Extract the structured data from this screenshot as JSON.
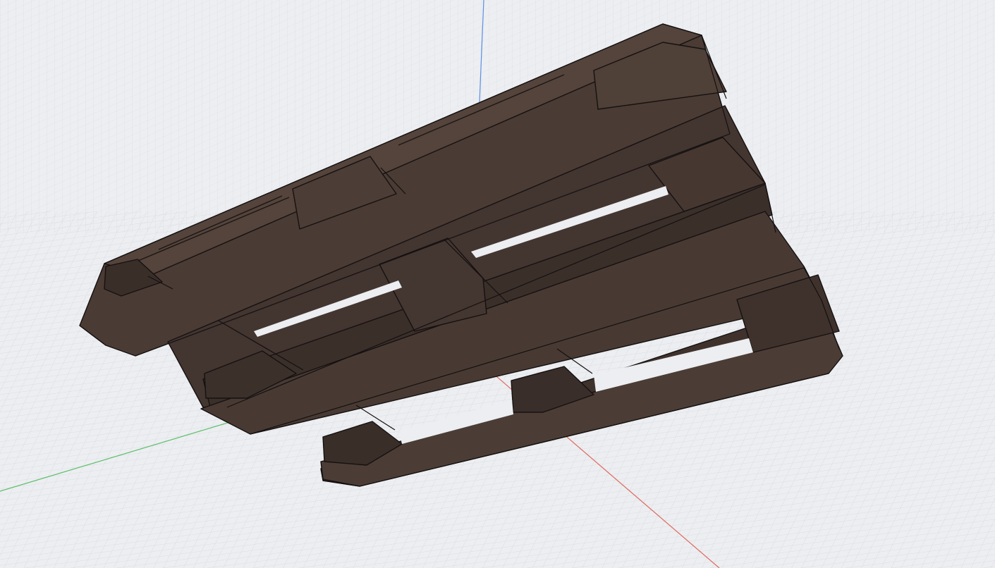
{
  "viewport": {
    "kind": "3d-model-view",
    "background_color": "#eceef1",
    "grid_color": "#c9ccd2",
    "axis_colors": {
      "x": "#e06a5e",
      "y": "#5bbf6a",
      "z": "#5b8ee6"
    }
  },
  "model": {
    "object": "pallet",
    "view": "underside-perspective",
    "colors": {
      "face_light": "#4f4038",
      "face_mid": "#453730",
      "face_dark": "#2e2420",
      "edge": "#161111"
    }
  }
}
